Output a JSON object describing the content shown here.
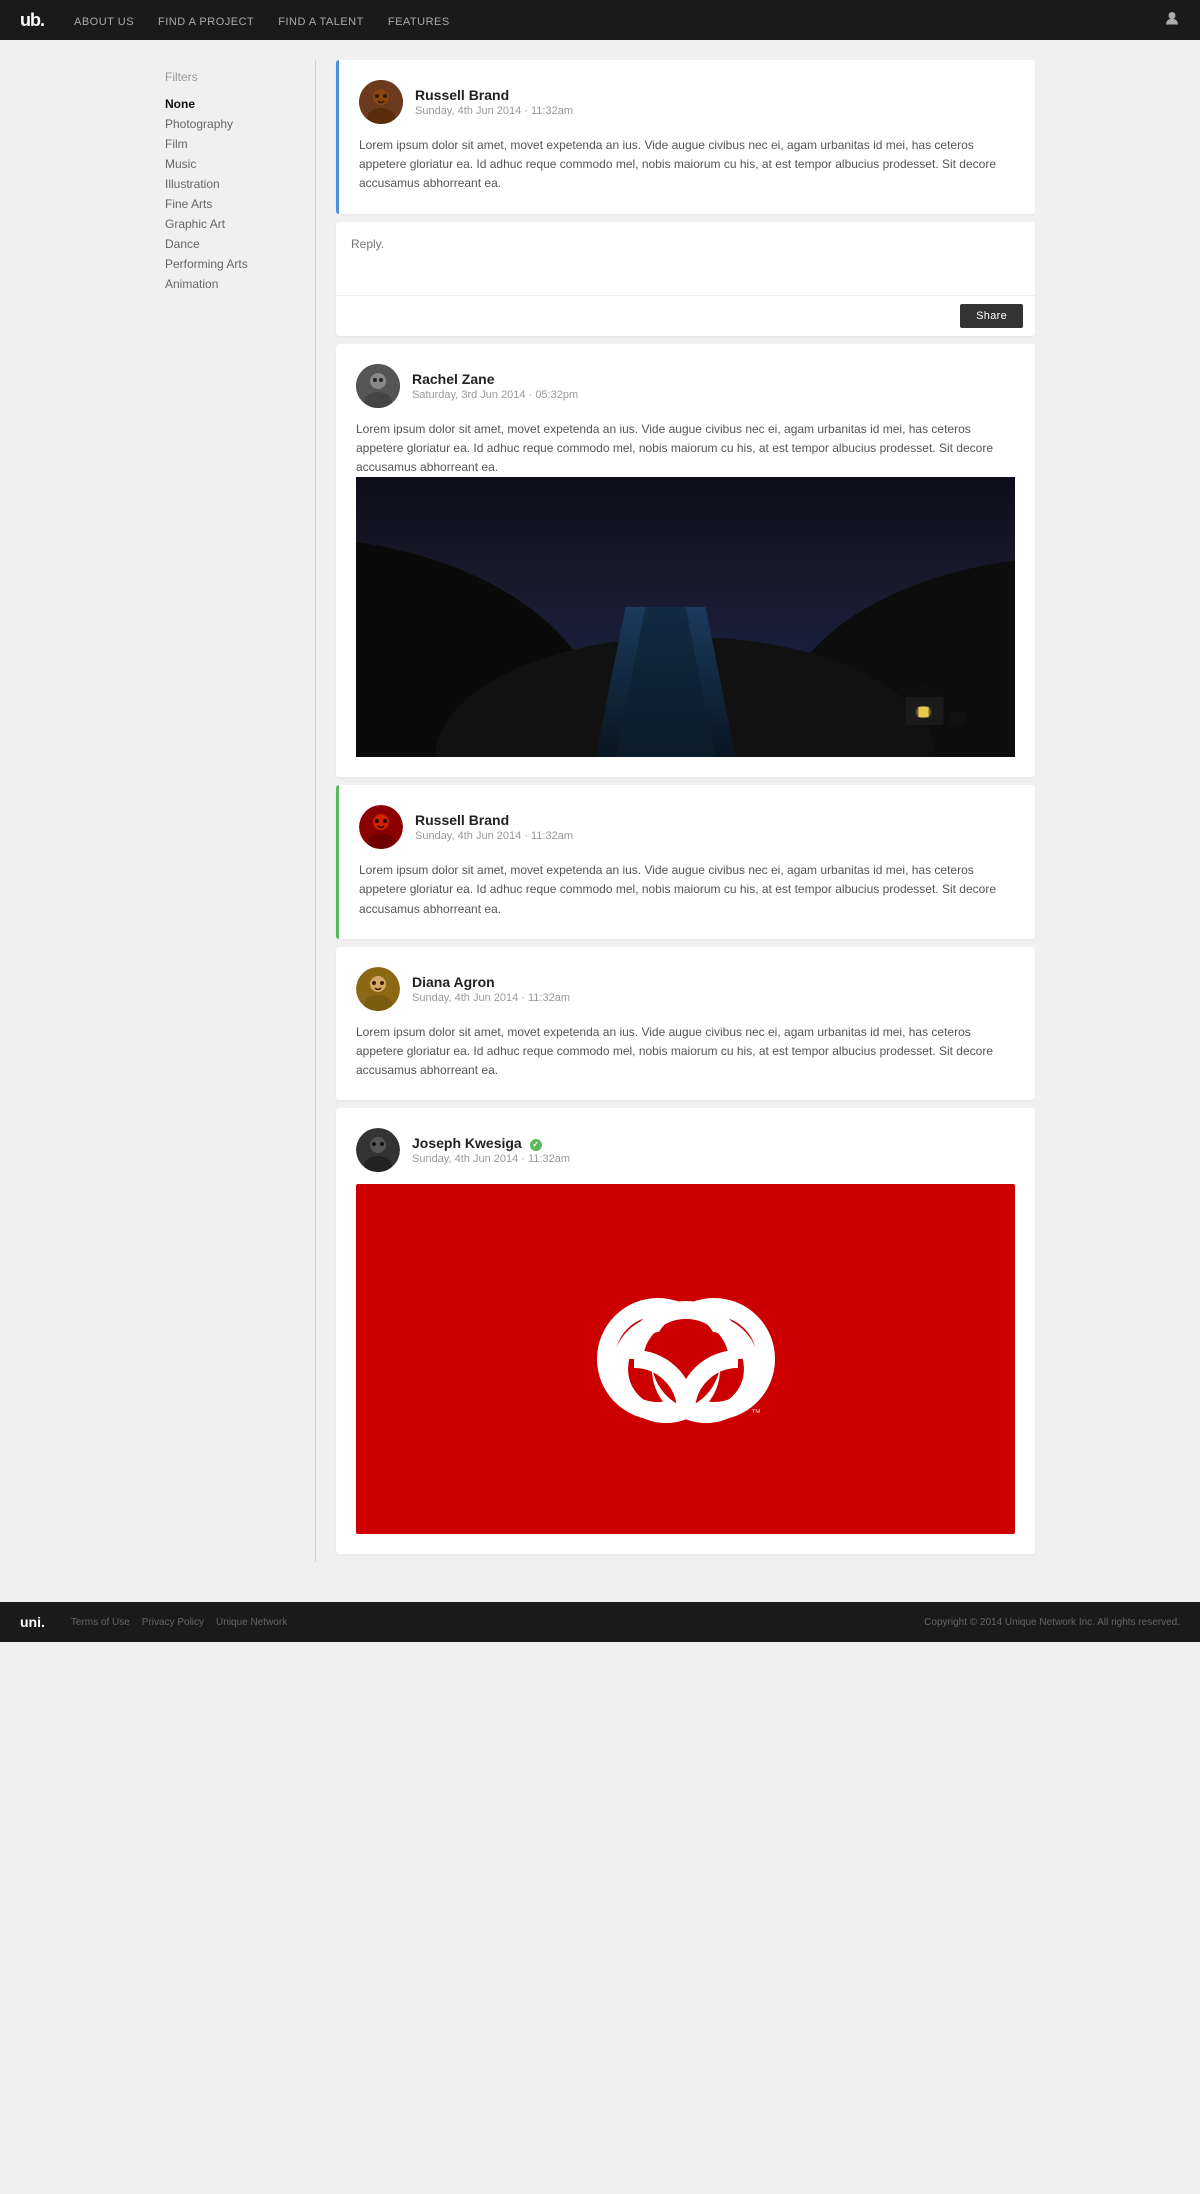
{
  "nav": {
    "logo": "ub.",
    "links": [
      {
        "label": "ABOUT US",
        "id": "about-us"
      },
      {
        "label": "FIND A PROJECT",
        "id": "find-project"
      },
      {
        "label": "FIND A TALENT",
        "id": "find-talent"
      },
      {
        "label": "FEATURES",
        "id": "features"
      }
    ]
  },
  "sidebar": {
    "filters_label": "Filters",
    "items": [
      {
        "label": "None",
        "active": true
      },
      {
        "label": "Photography",
        "active": false
      },
      {
        "label": "Film",
        "active": false
      },
      {
        "label": "Music",
        "active": false
      },
      {
        "label": "Illustration",
        "active": false
      },
      {
        "label": "Fine Arts",
        "active": false
      },
      {
        "label": "Graphic Art",
        "active": false
      },
      {
        "label": "Dance",
        "active": false
      },
      {
        "label": "Performing Arts",
        "active": false
      },
      {
        "label": "Animation",
        "active": false
      }
    ]
  },
  "posts": [
    {
      "id": "post-1",
      "author": "Russell Brand",
      "timestamp": "Sunday, 4th Jun 2014 · 11:32am",
      "body": "Lorem ipsum dolor sit amet, movet expetenda an ius. Vide augue civibus nec ei, agam urbanitas id mei, has ceteros appetere gloriatur ea. Id adhuc reque commodo mel, nobis maiorum cu his, at est tempor albucius prodesset. Sit decore accusamus abhorreant ea.",
      "accent": "blue",
      "verified": false,
      "has_image": false
    },
    {
      "id": "post-reply",
      "type": "reply",
      "placeholder": "Reply.",
      "button_label": "Share"
    },
    {
      "id": "post-2",
      "author": "Rachel Zane",
      "timestamp": "Saturday, 3rd Jun 2014 · 05:32pm",
      "body": "Lorem ipsum dolor sit amet, movet expetenda an ius. Vide augue civibus nec ei, agam urbanitas id mei, has ceteros appetere gloriatur ea. Id adhuc reque commodo mel, nobis maiorum cu his, at est tempor albucius prodesset. Sit decore accusamus abhorreant ea.",
      "accent": "none",
      "verified": false,
      "has_image": true,
      "image_type": "dark-landscape"
    },
    {
      "id": "post-3",
      "author": "Russell Brand",
      "timestamp": "Sunday, 4th Jun 2014 · 11:32am",
      "body": "Lorem ipsum dolor sit amet, movet expetenda an ius. Vide augue civibus nec ei, agam urbanitas id mei, has ceteros appetere gloriatur ea. Id adhuc reque commodo mel, nobis maiorum cu his, at est tempor albucius prodesset. Sit decore accusamus abhorreant ea.",
      "accent": "green",
      "verified": false,
      "has_image": false
    },
    {
      "id": "post-4",
      "author": "Diana Agron",
      "timestamp": "Sunday, 4th Jun 2014 · 11:32am",
      "body": "Lorem ipsum dolor sit amet, movet expetenda an ius. Vide augue civibus nec ei, agam urbanitas id mei, has ceteros appetere gloriatur ea. Id adhuc reque commodo mel, nobis maiorum cu his, at est tempor albucius prodesset. Sit decore accusamus abhorreant ea.",
      "accent": "none",
      "verified": false,
      "has_image": false
    },
    {
      "id": "post-5",
      "author": "Joseph Kwesiga",
      "timestamp": "Sunday, 4th Jun 2014 · 11:32am",
      "body": "",
      "accent": "none",
      "verified": true,
      "has_image": true,
      "image_type": "adobe-cc"
    }
  ],
  "footer": {
    "logo": "uni.",
    "links": [
      {
        "label": "Terms of Use"
      },
      {
        "label": "Privacy Policy"
      },
      {
        "label": "Unique Network"
      }
    ],
    "copyright": "Copyright © 2014 Unique Network Inc. All rights reserved."
  }
}
